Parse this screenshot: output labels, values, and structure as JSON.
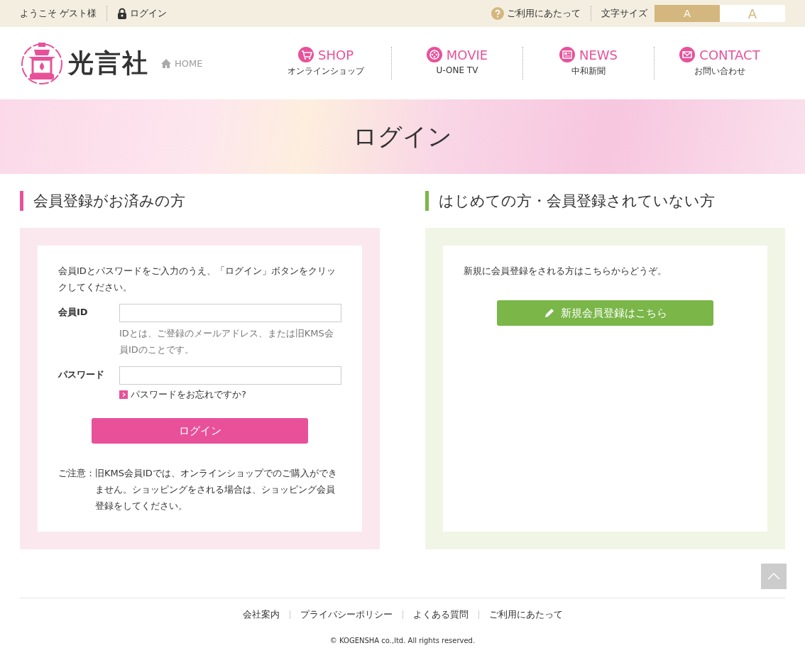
{
  "top_bar": {
    "welcome": "ようこそ ゲスト様",
    "login_link": "ログイン",
    "guide_link": "ご利用にあたって",
    "font_size_label": "文字サイズ",
    "font_sizes": [
      {
        "label": "A",
        "selected": true
      },
      {
        "label": "A",
        "selected": false
      }
    ]
  },
  "header": {
    "logo": "光言社",
    "home_link": "HOME",
    "nav": [
      {
        "kind": "shop",
        "label": "SHOP",
        "sub": "オンラインショップ"
      },
      {
        "kind": "movie",
        "label": "MOVIE",
        "sub": "U-ONE TV"
      },
      {
        "kind": "news",
        "label": "NEWS",
        "sub": "中和新聞"
      },
      {
        "kind": "contact",
        "label": "CONTACT",
        "sub": "お問い合わせ"
      }
    ]
  },
  "page_title": "ログイン",
  "member_section": {
    "heading": "会員登録がお済みの方",
    "intro": "会員IDとパスワードをご入力のうえ、「ログイン」ボタンをクリックしてください。",
    "fields": [
      {
        "label": "会員ID",
        "hint": "IDとは、ご登録のメールアドレス、または旧KMS会員IDのことです。"
      },
      {
        "label": "パスワード"
      }
    ],
    "forgot_link": "パスワードをお忘れですか?",
    "login_button": "ログイン",
    "note_label": "ご注意：",
    "note": "旧KMS会員IDでは、オンラインショップでのご購入ができません。ショッピングをされる場合は、ショッピング会員登録をしてください。"
  },
  "new_section": {
    "heading": "はじめての方・会員登録されていない方",
    "text": "新規に会員登録をされる方はこちらからどうぞ。",
    "register_button": "新規会員登録はこちら"
  },
  "footer": {
    "links": [
      "会社案内",
      "プライバシーポリシー",
      "よくある質問",
      "ご利用にあたって"
    ],
    "copyright": "© KOGENSHA co.,ltd. All rights reserved."
  }
}
